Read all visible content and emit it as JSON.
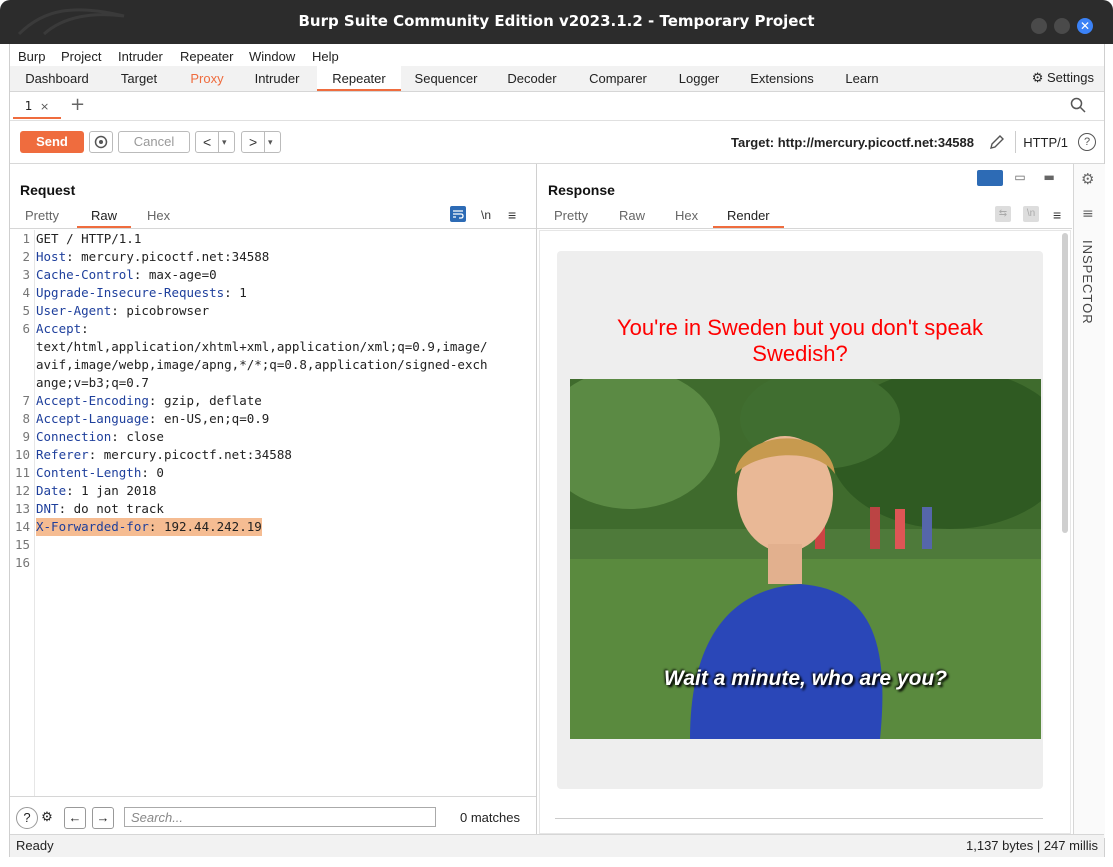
{
  "window": {
    "title": "Burp Suite Community Edition v2023.1.2 - Temporary Project"
  },
  "menu": [
    "Burp",
    "Project",
    "Intruder",
    "Repeater",
    "Window",
    "Help"
  ],
  "top_tabs": [
    "Dashboard",
    "Target",
    "Proxy",
    "Intruder",
    "Repeater",
    "Sequencer",
    "Decoder",
    "Comparer",
    "Logger",
    "Extensions",
    "Learn"
  ],
  "settings_label": "Settings",
  "repeater_tab": {
    "label": "1",
    "close": "×"
  },
  "toolbar": {
    "send": "Send",
    "cancel": "Cancel",
    "back": "<",
    "forward": ">",
    "target": "Target: http://mercury.picoctf.net:34588",
    "http_version": "HTTP/1"
  },
  "request": {
    "title": "Request",
    "view_tabs": [
      "Pretty",
      "Raw",
      "Hex"
    ],
    "newline_toggle": "\\n",
    "lines": [
      {
        "n": "1",
        "name": "",
        "value": "GET / HTTP/1.1"
      },
      {
        "n": "2",
        "name": "Host",
        "value": ": mercury.picoctf.net:34588"
      },
      {
        "n": "3",
        "name": "Cache-Control",
        "value": ": max-age=0"
      },
      {
        "n": "4",
        "name": "Upgrade-Insecure-Requests",
        "value": ": 1"
      },
      {
        "n": "5",
        "name": "User-Agent",
        "value": ": picobrowser"
      },
      {
        "n": "6",
        "name": "Accept",
        "value": ":"
      },
      {
        "n": "",
        "name": "",
        "value": "text/html,application/xhtml+xml,application/xml;q=0.9,image/"
      },
      {
        "n": "",
        "name": "",
        "value": "avif,image/webp,image/apng,*/*;q=0.8,application/signed-exch"
      },
      {
        "n": "",
        "name": "",
        "value": "ange;v=b3;q=0.7"
      },
      {
        "n": "7",
        "name": "Accept-Encoding",
        "value": ": gzip, deflate"
      },
      {
        "n": "8",
        "name": "Accept-Language",
        "value": ": en-US,en;q=0.9"
      },
      {
        "n": "9",
        "name": "Connection",
        "value": ": close"
      },
      {
        "n": "10",
        "name": "Referer",
        "value": ": mercury.picoctf.net:34588"
      },
      {
        "n": "11",
        "name": "Content-Length",
        "value": ": 0"
      },
      {
        "n": "12",
        "name": "Date",
        "value": ": 1 jan 2018"
      },
      {
        "n": "13",
        "name": "DNT",
        "value": ": do not track"
      },
      {
        "n": "14",
        "name": "X-Forwarded-for",
        "value": ": 192.44.242.19",
        "highlight": true
      },
      {
        "n": "15",
        "name": "",
        "value": ""
      },
      {
        "n": "16",
        "name": "",
        "value": ""
      }
    ],
    "search_placeholder": "Search...",
    "matches": "0 matches"
  },
  "response": {
    "title": "Response",
    "view_tabs": [
      "Pretty",
      "Raw",
      "Hex",
      "Render"
    ],
    "newline_toggle": "\\n",
    "render": {
      "heading": "You're in Sweden but you don't speak Swedish?",
      "caption": "Wait a minute, who are you?"
    }
  },
  "inspector_label": "INSPECTOR",
  "status": {
    "left": "Ready",
    "right": "1,137 bytes | 247 millis"
  },
  "colors": {
    "accent": "#ef6c3e",
    "header_name": "#1e3f9c",
    "highlight": "#f5bc92",
    "render_heading": "#ff0000"
  }
}
